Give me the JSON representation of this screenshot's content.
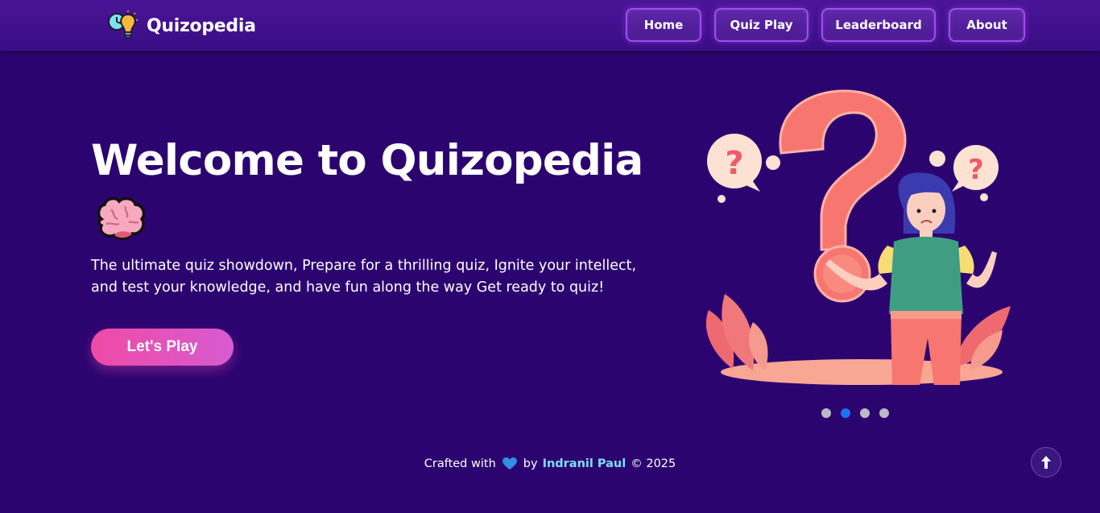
{
  "brand": {
    "name": "Quizopedia",
    "logo_icon": "lightbulb-clock-icon"
  },
  "nav": {
    "items": [
      {
        "label": "Home"
      },
      {
        "label": "Quiz Play"
      },
      {
        "label": "Leaderboard"
      },
      {
        "label": "About"
      }
    ]
  },
  "hero": {
    "title": "Welcome to Quizopedia",
    "emoji_icon": "brain-icon",
    "description": "The ultimate quiz showdown, Prepare for a thrilling quiz, Ignite your intellect, and test your knowledge, and have fun along the way Get ready to quiz!",
    "cta_label": "Let's Play",
    "illustration": "confused-girl-question-mark-illustration"
  },
  "carousel": {
    "slide_count": 4,
    "active_index": 1
  },
  "footer": {
    "prefix": "Crafted with",
    "heart_icon": "heart-icon",
    "by": "by",
    "author": "Indranil Paul",
    "copyright": "© 2025"
  },
  "scroll_top_icon": "arrow-up-icon",
  "colors": {
    "background": "#2c0470",
    "navbar": "#4a1597",
    "cta_gradient_start": "#f04aa6",
    "cta_gradient_end": "#d75bd0",
    "author_link": "#7fdcff",
    "active_dot": "#1a73f0"
  }
}
